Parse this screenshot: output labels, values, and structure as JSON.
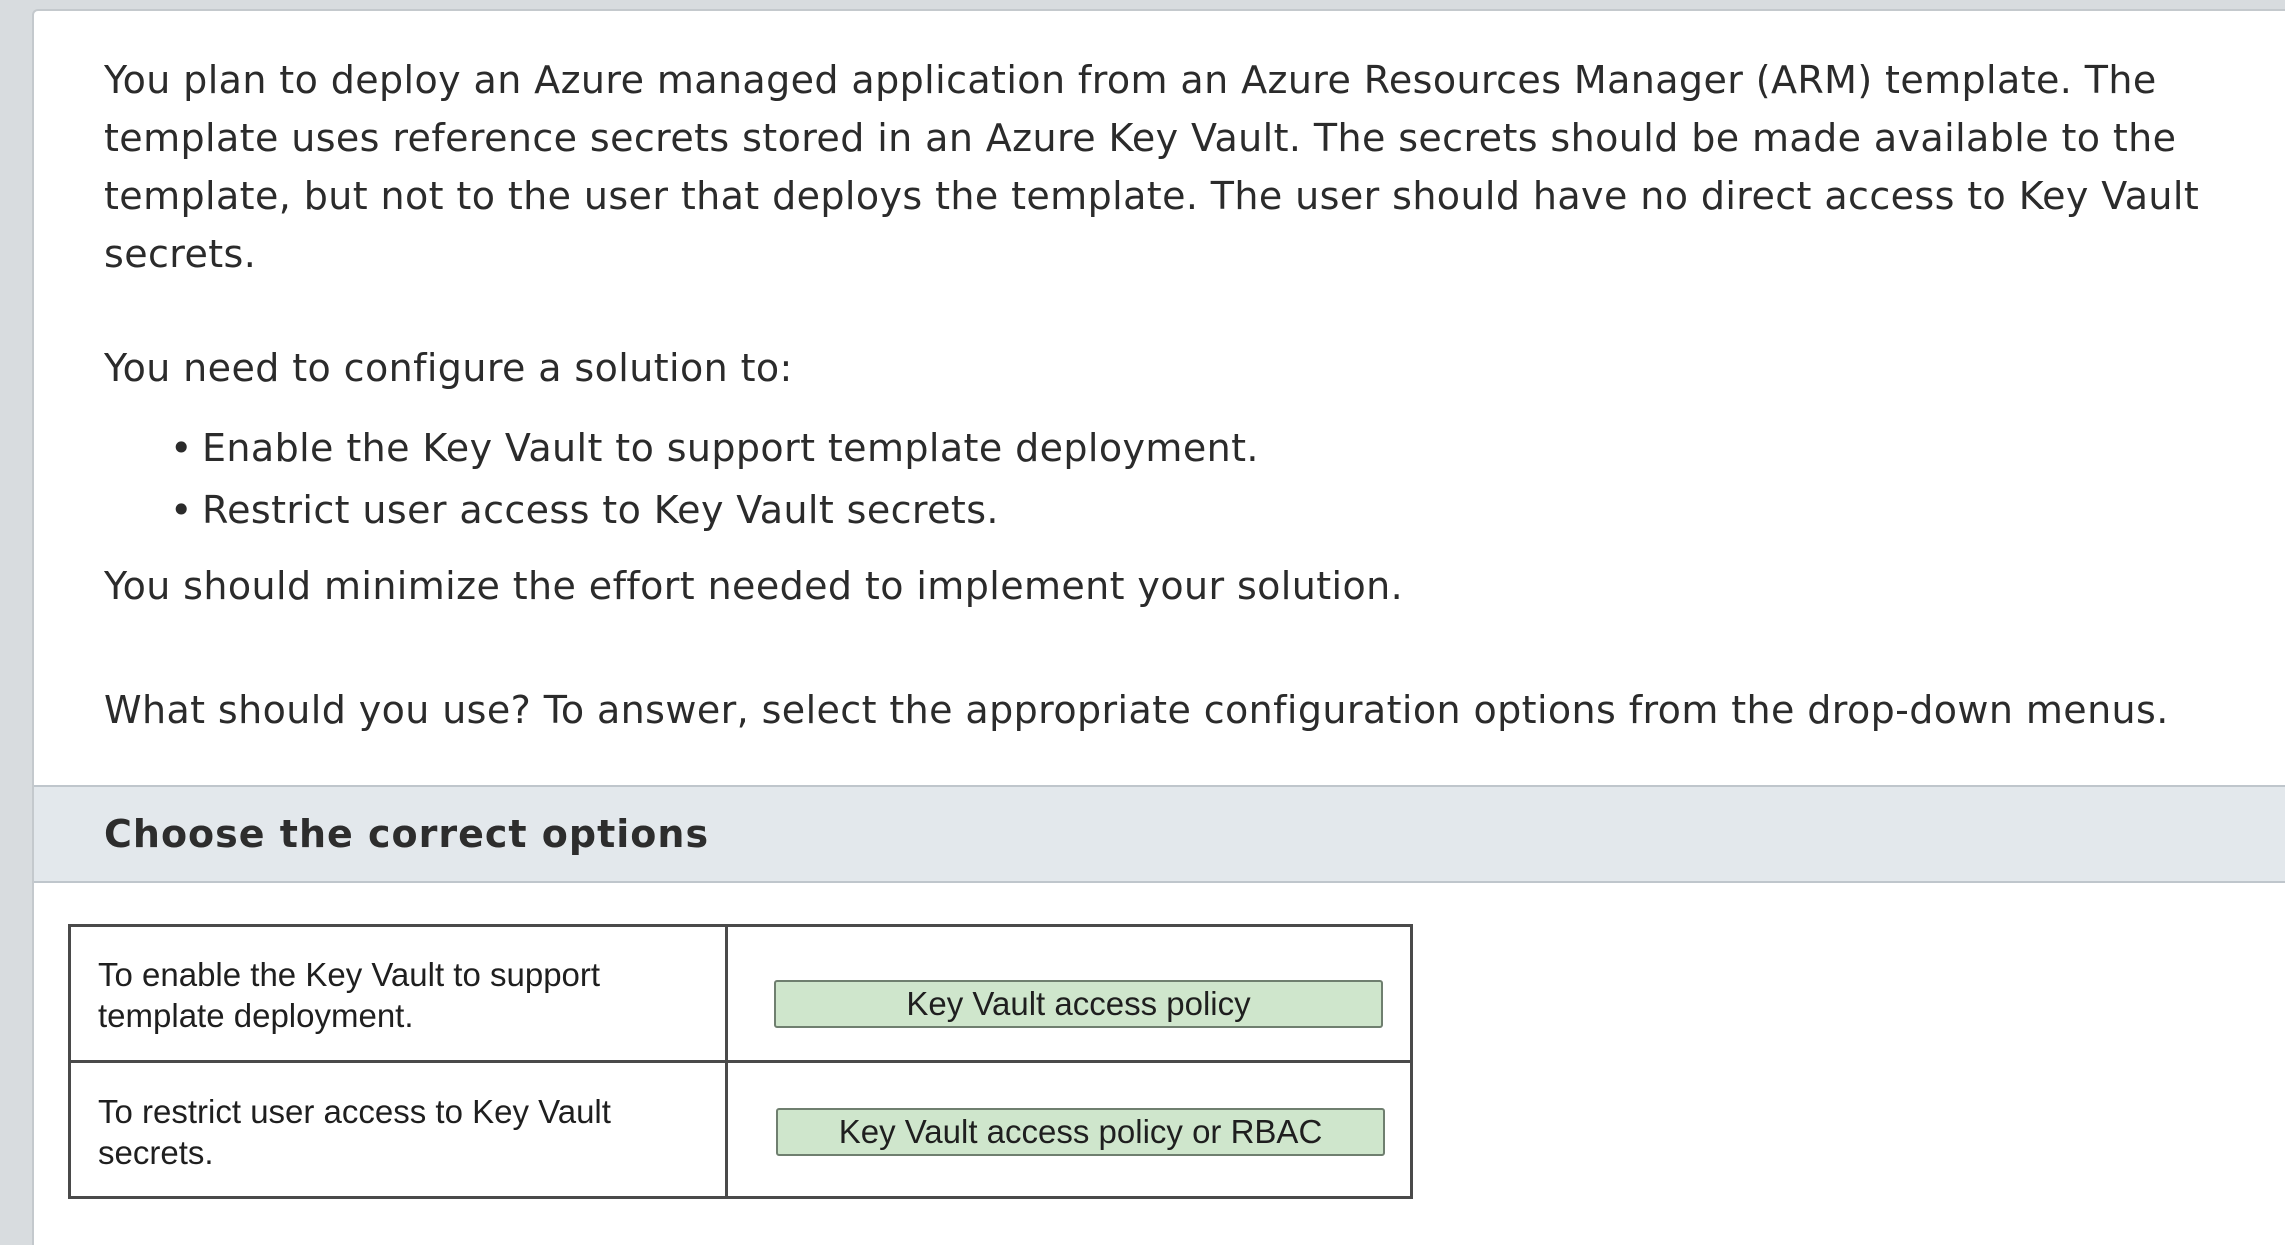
{
  "question": {
    "paragraph_1": "You plan to deploy an Azure managed application from an Azure Resources Manager (ARM) template. The template uses reference secrets stored in an Azure Key Vault. The secrets should be made available to the template, but not to the user that deploys the template. The user should have no direct access to Key Vault secrets.",
    "paragraph_2": "You need to configure a solution to:",
    "bullets": [
      "Enable the Key Vault to support template deployment.",
      "Restrict user access to Key Vault secrets."
    ],
    "paragraph_3": "You should minimize the effort needed to implement your solution.",
    "paragraph_4": "What should you use? To answer, select the appropriate configuration options from the drop-down menus."
  },
  "options_section": {
    "title": "Choose the correct options"
  },
  "answer_table": {
    "rows": [
      {
        "label_line_1": "To enable the Key Vault to support",
        "label_line_2": "template deployment.",
        "selected_option": "Key Vault access policy"
      },
      {
        "label_line_1": "To restrict user access to Key Vault",
        "label_line_2": "secrets.",
        "selected_option": "Key Vault access policy or RBAC"
      }
    ]
  },
  "colors": {
    "dropdown_fill": "#cfe6cc",
    "header_band": "#e3e8ec",
    "background": "#d8dcdf"
  },
  "icons": {
    "bullet": "•"
  }
}
